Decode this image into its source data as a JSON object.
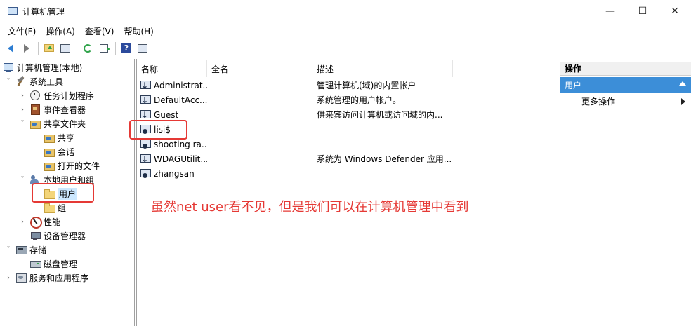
{
  "window": {
    "title": "计算机管理",
    "minimize_glyph": "—",
    "maximize_glyph": "☐",
    "close_glyph": "✕"
  },
  "menu": {
    "items": [
      "文件(F)",
      "操作(A)",
      "查看(V)",
      "帮助(H)"
    ]
  },
  "toolbar": {
    "icons": [
      "back-icon",
      "forward-icon",
      "up-folder-icon",
      "show-hide-tree-icon",
      "refresh-icon",
      "export-icon",
      "help-icon",
      "show-action-pane-icon"
    ]
  },
  "tree": {
    "root": "计算机管理(本地)",
    "system_tools": "系统工具",
    "task_scheduler": "任务计划程序",
    "event_viewer": "事件查看器",
    "shared_folders": "共享文件夹",
    "shares": "共享",
    "sessions": "会话",
    "open_files": "打开的文件",
    "local_users_groups": "本地用户和组",
    "users": "用户",
    "groups": "组",
    "performance": "性能",
    "device_manager": "设备管理器",
    "storage": "存储",
    "disk_management": "磁盘管理",
    "services_apps": "服务和应用程序"
  },
  "list": {
    "columns": {
      "name": "名称",
      "full_name": "全名",
      "description": "描述"
    },
    "rows": [
      {
        "name": "Administrat...",
        "full_name": "",
        "description": "管理计算机(域)的内置帐户",
        "icon": "user-disabled-icon"
      },
      {
        "name": "DefaultAcc...",
        "full_name": "",
        "description": "系统管理的用户帐户。",
        "icon": "user-disabled-icon"
      },
      {
        "name": "Guest",
        "full_name": "",
        "description": "供来宾访问计算机或访问域的内...",
        "icon": "user-disabled-icon"
      },
      {
        "name": "lisi$",
        "full_name": "",
        "description": "",
        "icon": "user-icon"
      },
      {
        "name": "shooting ra...",
        "full_name": "",
        "description": "",
        "icon": "user-icon"
      },
      {
        "name": "WDAGUtilit...",
        "full_name": "",
        "description": "系统为 Windows Defender 应用...",
        "icon": "user-disabled-icon"
      },
      {
        "name": "zhangsan",
        "full_name": "",
        "description": "",
        "icon": "user-icon"
      }
    ]
  },
  "annotation": {
    "text": "虽然net user看不见，但是我们可以在计算机管理中看到",
    "color": "#e53935"
  },
  "actions": {
    "title": "操作",
    "section": "用户",
    "more": "更多操作"
  },
  "colors": {
    "selection": "#cce8ff",
    "actions_header": "#3c8ed8",
    "highlight": "#e53935"
  }
}
